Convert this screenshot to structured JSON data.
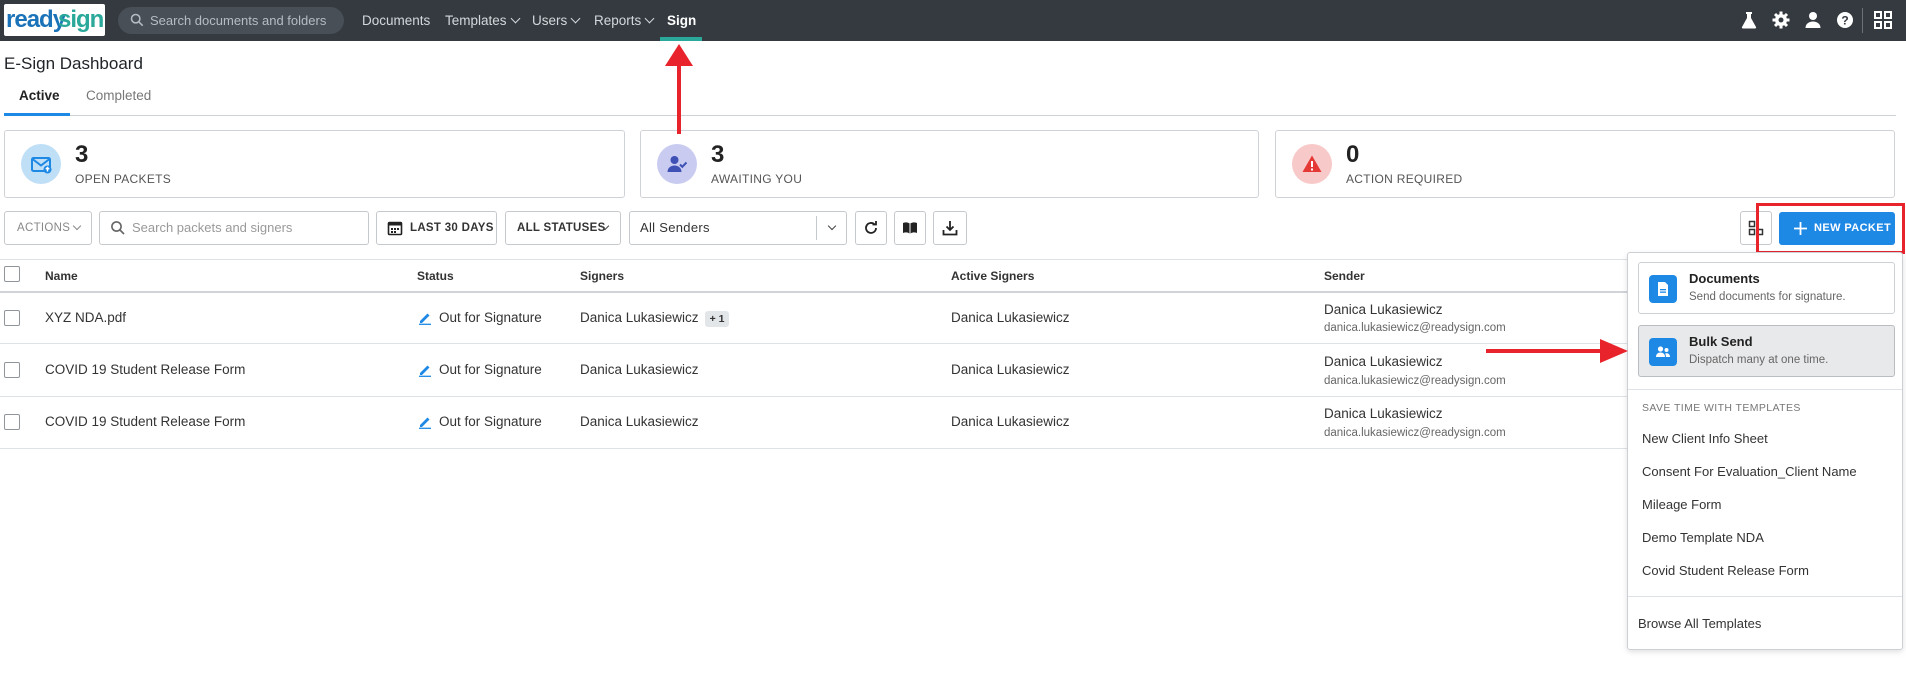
{
  "nav": {
    "logo_part1": "ready",
    "logo_part2": "sign",
    "search_placeholder": "Search documents and folders",
    "items": [
      {
        "label": "Documents"
      },
      {
        "label": "Templates"
      },
      {
        "label": "Users"
      },
      {
        "label": "Reports"
      },
      {
        "label": "Sign"
      }
    ],
    "active_item": "Sign",
    "icons": [
      "flask-icon",
      "gear-icon",
      "user-icon",
      "help-icon",
      "apps-grid-icon"
    ]
  },
  "page": {
    "title": "E-Sign Dashboard",
    "tabs": [
      {
        "label": "Active"
      },
      {
        "label": "Completed"
      }
    ],
    "active_tab": "Active"
  },
  "stats": [
    {
      "value": "3",
      "label": "OPEN PACKETS",
      "icon": "envelope-icon",
      "color": "#1e88e5",
      "bg": "#bfdff7"
    },
    {
      "value": "3",
      "label": "AWAITING YOU",
      "icon": "user-check-icon",
      "color": "#3f51b5",
      "bg": "#c9ccf0"
    },
    {
      "value": "0",
      "label": "ACTION REQUIRED",
      "icon": "warning-icon",
      "color": "#e53935",
      "bg": "#f8c9c9"
    }
  ],
  "toolbar": {
    "actions_label": "ACTIONS",
    "search_placeholder": "Search packets and signers",
    "date_filter": "LAST 30 DAYS",
    "status_filter": "ALL STATUSES",
    "sender_filter": "All Senders",
    "new_packet_label": "NEW PACKET"
  },
  "table": {
    "columns": [
      "Name",
      "Status",
      "Signers",
      "Active Signers",
      "Sender"
    ],
    "rows": [
      {
        "name": "XYZ NDA.pdf",
        "status": "Out for Signature",
        "signers": "Danica Lukasiewicz",
        "extra": "+ 1",
        "active_signers": "Danica Lukasiewicz",
        "sender": "Danica Lukasiewicz",
        "sender_email": "danica.lukasiewicz@readysign.com"
      },
      {
        "name": "COVID 19 Student Release Form",
        "status": "Out for Signature",
        "signers": "Danica Lukasiewicz",
        "extra": "",
        "active_signers": "Danica Lukasiewicz",
        "sender": "Danica Lukasiewicz",
        "sender_email": "danica.lukasiewicz@readysign.com"
      },
      {
        "name": "COVID 19 Student Release Form",
        "status": "Out for Signature",
        "signers": "Danica Lukasiewicz",
        "extra": "",
        "active_signers": "Danica Lukasiewicz",
        "sender": "Danica Lukasiewicz",
        "sender_email": "danica.lukasiewicz@readysign.com"
      }
    ]
  },
  "dropdown": {
    "options": [
      {
        "title": "Documents",
        "desc": "Send documents for signature."
      },
      {
        "title": "Bulk Send",
        "desc": "Dispatch many at one time."
      }
    ],
    "section_label": "SAVE TIME WITH TEMPLATES",
    "templates": [
      "New Client Info Sheet",
      "Consent For Evaluation_Client Name",
      "Mileage Form",
      "Demo Template NDA",
      "Covid Student Release Form"
    ],
    "browse_label": "Browse All Templates"
  },
  "colors": {
    "navbar": "#343a40",
    "accent": "#1e88e5",
    "active_underline": "#2aa89a",
    "annotation": "#e8232b"
  }
}
